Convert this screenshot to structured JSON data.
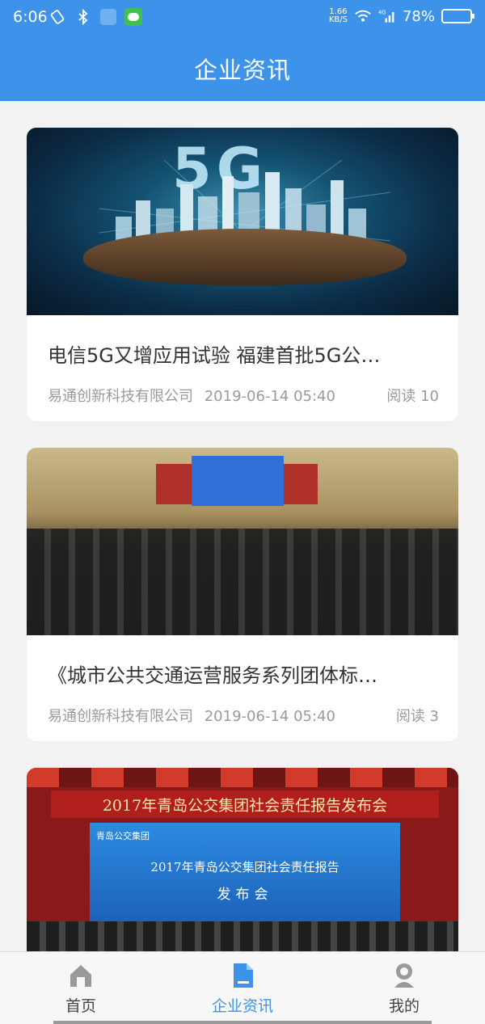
{
  "status_bar": {
    "time": "6:06",
    "net_speed_value": "1.66",
    "net_speed_unit": "KB/S",
    "network_type": "4G",
    "battery_percent": "78%",
    "battery_level": 0.78,
    "icons": [
      "screen-rotate-icon",
      "bluetooth-icon",
      "lock-app-icon",
      "message-app-icon",
      "wifi-icon",
      "signal-icon",
      "battery-icon"
    ]
  },
  "header": {
    "title": "企业资讯"
  },
  "articles": [
    {
      "title": "电信5G又增应用试验 福建首批5G公…",
      "source": "易通创新科技有限公司",
      "date": "2019-06-14 05:40",
      "reads": "阅读 10"
    },
    {
      "title": "《城市公共交通运营服务系列团体标…",
      "source": "易通创新科技有限公司",
      "date": "2019-06-14 05:40",
      "reads": "阅读 3"
    },
    {
      "banner": "2017年青岛公交集团社会责任报告发布会",
      "screen_logo": "青岛公交集团",
      "screen_line1": "2017年青岛公交集团社会责任报告",
      "screen_line2": "发布会"
    }
  ],
  "image_text": {
    "fiveg": "5G"
  },
  "tabbar": {
    "items": [
      {
        "label": "首页",
        "icon": "home-icon",
        "active": false
      },
      {
        "label": "企业资讯",
        "icon": "document-icon",
        "active": true
      },
      {
        "label": "我的",
        "icon": "profile-icon",
        "active": false
      }
    ],
    "active_color": "#3d93ea"
  },
  "colors": {
    "primary": "#3d93ea",
    "background": "#f2f2f2",
    "meta_text": "#9a9a9a"
  }
}
